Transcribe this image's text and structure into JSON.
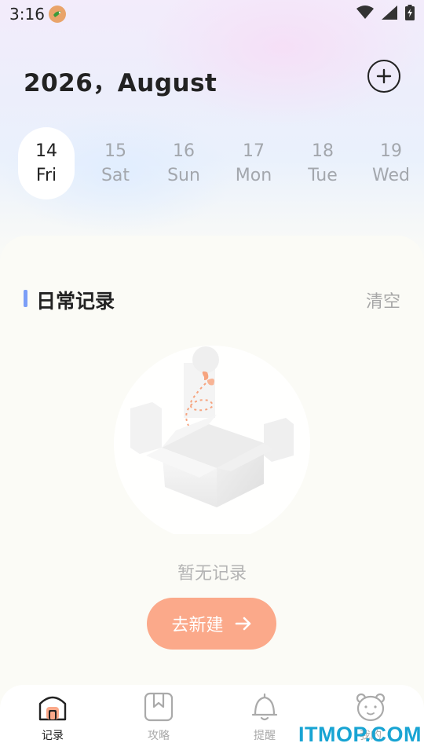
{
  "status_bar": {
    "time": "3:16"
  },
  "header": {
    "month_title": "2026，August",
    "add_icon": "plus-circle-icon"
  },
  "dates": [
    {
      "day": "14",
      "weekday": "Fri",
      "selected": true
    },
    {
      "day": "15",
      "weekday": "Sat",
      "selected": false
    },
    {
      "day": "16",
      "weekday": "Sun",
      "selected": false
    },
    {
      "day": "17",
      "weekday": "Mon",
      "selected": false
    },
    {
      "day": "18",
      "weekday": "Tue",
      "selected": false
    },
    {
      "day": "19",
      "weekday": "Wed",
      "selected": false
    }
  ],
  "section": {
    "title": "日常记录",
    "clear_label": "清空"
  },
  "empty_state": {
    "text": "暂无记录",
    "button_label": "去新建",
    "illustration": "empty-box-illustration"
  },
  "bottom_nav": {
    "items": [
      {
        "label": "记录",
        "icon": "house-icon",
        "active": true
      },
      {
        "label": "攻略",
        "icon": "bookmark-book-icon",
        "active": false
      },
      {
        "label": "提醒",
        "icon": "bell-icon",
        "active": false
      },
      {
        "label": "我的",
        "icon": "bear-face-icon",
        "active": false
      }
    ]
  },
  "watermark": "ITMOP.COM",
  "colors": {
    "accent_orange": "#fba98a",
    "section_bar_blue": "#7b9ef7",
    "watermark_blue": "#18a4d3"
  }
}
